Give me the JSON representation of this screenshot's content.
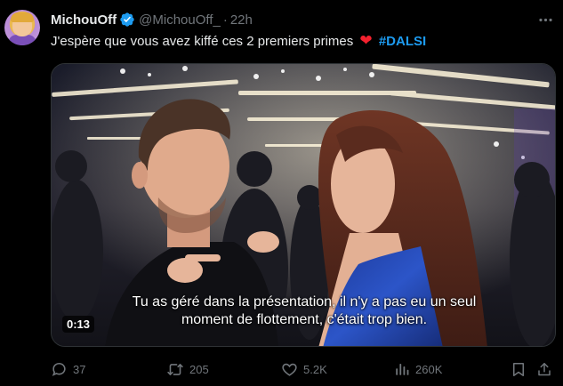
{
  "tweet": {
    "author_name": "MichouOff",
    "handle": "@MichouOff_",
    "separator": "·",
    "time": "22h",
    "text": "J'espère que vous avez kiffé ces 2 premiers primes",
    "emoji": "❤",
    "hashtag": "#DALSI",
    "verified_icon": "verified-badge-icon",
    "more_icon": "more-options-icon"
  },
  "video": {
    "subtitle_line1": "Tu as géré dans la présentation, il n'y a pas eu un seul",
    "subtitle_line2": "moment de flottement, c'était trop bien.",
    "duration": "0:13"
  },
  "actions": {
    "replies": "37",
    "retweets": "205",
    "likes": "5.2K",
    "views": "260K"
  },
  "colors": {
    "background": "#000000",
    "text": "#e7e9ea",
    "secondary": "#71767b",
    "accent": "#1d9bf0",
    "heart": "#f4212e"
  }
}
